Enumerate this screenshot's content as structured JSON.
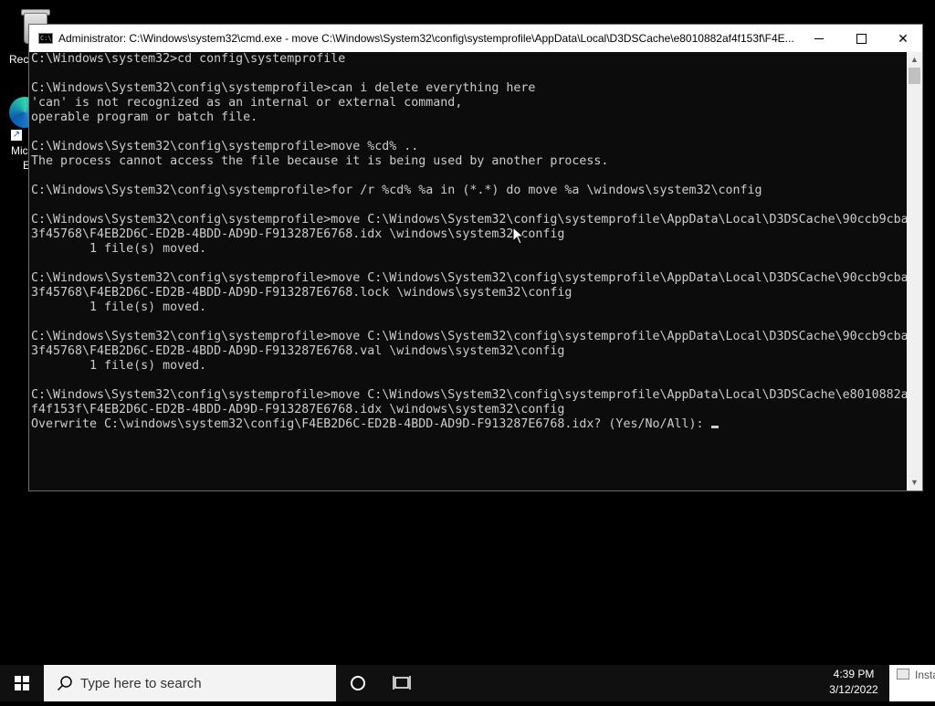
{
  "desktop": {
    "recycle_bin_label": "Recy",
    "edge_label_line1": "Mic",
    "edge_label_line2": "E"
  },
  "window": {
    "title": "Administrator: C:\\Windows\\system32\\cmd.exe - move  C:\\Windows\\System32\\config\\systemprofile\\AppData\\Local\\D3DSCache\\e8010882af4f153f\\F4E...",
    "title_icon_text": "C:\\",
    "controls": {
      "minimize": "minimize",
      "maximize": "maximize",
      "close": "✕"
    }
  },
  "console": {
    "lines": [
      "C:\\Windows\\system32>cd config\\systemprofile",
      "",
      "C:\\Windows\\System32\\config\\systemprofile>can i delete everything here",
      "'can' is not recognized as an internal or external command,",
      "operable program or batch file.",
      "",
      "C:\\Windows\\System32\\config\\systemprofile>move %cd% ..",
      "The process cannot access the file because it is being used by another process.",
      "",
      "C:\\Windows\\System32\\config\\systemprofile>for /r %cd% %a in (*.*) do move %a \\windows\\system32\\config",
      "",
      "C:\\Windows\\System32\\config\\systemprofile>move C:\\Windows\\System32\\config\\systemprofile\\AppData\\Local\\D3DSCache\\90ccb9cba",
      "3f45768\\F4EB2D6C-ED2B-4BDD-AD9D-F913287E6768.idx \\windows\\system32\\config",
      "        1 file(s) moved.",
      "",
      "C:\\Windows\\System32\\config\\systemprofile>move C:\\Windows\\System32\\config\\systemprofile\\AppData\\Local\\D3DSCache\\90ccb9cba",
      "3f45768\\F4EB2D6C-ED2B-4BDD-AD9D-F913287E6768.lock \\windows\\system32\\config",
      "        1 file(s) moved.",
      "",
      "C:\\Windows\\System32\\config\\systemprofile>move C:\\Windows\\System32\\config\\systemprofile\\AppData\\Local\\D3DSCache\\90ccb9cba",
      "3f45768\\F4EB2D6C-ED2B-4BDD-AD9D-F913287E6768.val \\windows\\system32\\config",
      "        1 file(s) moved.",
      "",
      "C:\\Windows\\System32\\config\\systemprofile>move C:\\Windows\\System32\\config\\systemprofile\\AppData\\Local\\D3DSCache\\e8010882a",
      "f4f153f\\F4EB2D6C-ED2B-4BDD-AD9D-F913287E6768.idx \\windows\\system32\\config",
      "Overwrite C:\\windows\\system32\\config\\F4EB2D6C-ED2B-4BDD-AD9D-F913287E6768.idx? (Yes/No/All): "
    ]
  },
  "taskbar": {
    "search_placeholder": "Type here to search",
    "time": "4:39 PM",
    "date": "3/12/2022",
    "installer_label": "Insta"
  },
  "colors": {
    "console_bg": "#0c0c0c",
    "console_fg": "#cccccc",
    "taskbar_bg": "#101010",
    "search_bg": "#f3f3f3"
  }
}
